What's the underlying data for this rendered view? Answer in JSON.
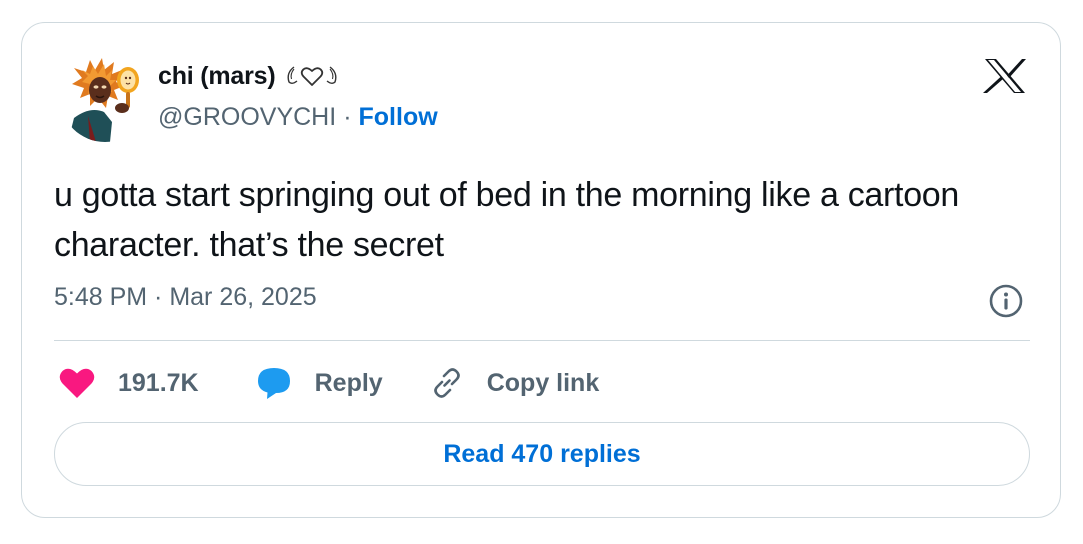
{
  "author": {
    "display_name": "chi (mars)",
    "name_emoji": "wings-heart-emoji",
    "handle": "@GROOVYCHI",
    "separator": "·",
    "follow_label": "Follow"
  },
  "tweet": {
    "text": "u gotta start springing out of bed in the morning like a cartoon character. that’s the secret",
    "timestamp": "5:48 PM · Mar 26, 2025"
  },
  "actions": {
    "like_count": "191.7K",
    "reply_label": "Reply",
    "copy_link_label": "Copy link"
  },
  "footer": {
    "read_replies_label": "Read 470 replies"
  },
  "icons": {
    "logo": "x-logo-icon",
    "info": "info-icon",
    "like": "heart-icon",
    "reply": "speech-bubble-icon",
    "copy_link": "link-icon"
  },
  "colors": {
    "link_blue": "#006fd6",
    "like_pink": "#f91880",
    "reply_blue": "#1d9bf0",
    "secondary_text": "#536471",
    "border": "#cfd9de"
  }
}
